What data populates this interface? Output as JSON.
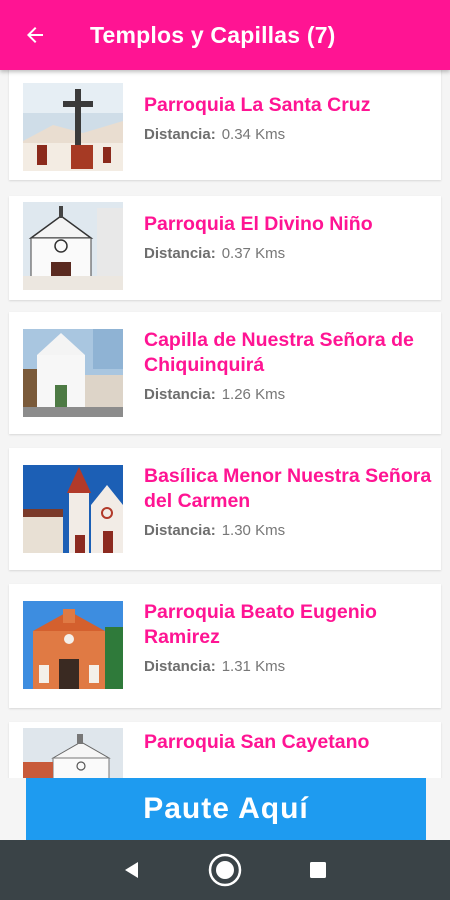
{
  "app": {
    "title": "Templos y Capillas (7)"
  },
  "icons": {
    "back": "arrow-back-icon",
    "nav_back": "triangle-back-icon",
    "nav_home": "circle-home-icon",
    "nav_recents": "square-recents-icon"
  },
  "colors": {
    "primary": "#ff1493",
    "banner": "#1e9bf0",
    "navbar": "#3a4347"
  },
  "places": [
    {
      "name_lines": [
        "Parroquia La Santa Cruz"
      ],
      "distance_label": "Distancia:",
      "distance_value": "0.34 Kms"
    },
    {
      "name_lines": [
        "Parroquia El Divino Niño"
      ],
      "distance_label": "Distancia:",
      "distance_value": "0.37 Kms"
    },
    {
      "name_lines": [
        "Capilla de Nuestra Señora de",
        "Chiquinquirá"
      ],
      "distance_label": "Distancia:",
      "distance_value": "1.26 Kms"
    },
    {
      "name_lines": [
        "Basílica Menor Nuestra Señora",
        "del Carmen"
      ],
      "distance_label": "Distancia:",
      "distance_value": "1.30 Kms"
    },
    {
      "name_lines": [
        "Parroquia Beato Eugenio",
        "Ramirez"
      ],
      "distance_label": "Distancia:",
      "distance_value": "1.31 Kms"
    },
    {
      "name_lines": [
        "Parroquia San Cayetano"
      ],
      "distance_label": "",
      "distance_value": ""
    }
  ],
  "ad_banner": {
    "label": "Paute Aquí"
  }
}
